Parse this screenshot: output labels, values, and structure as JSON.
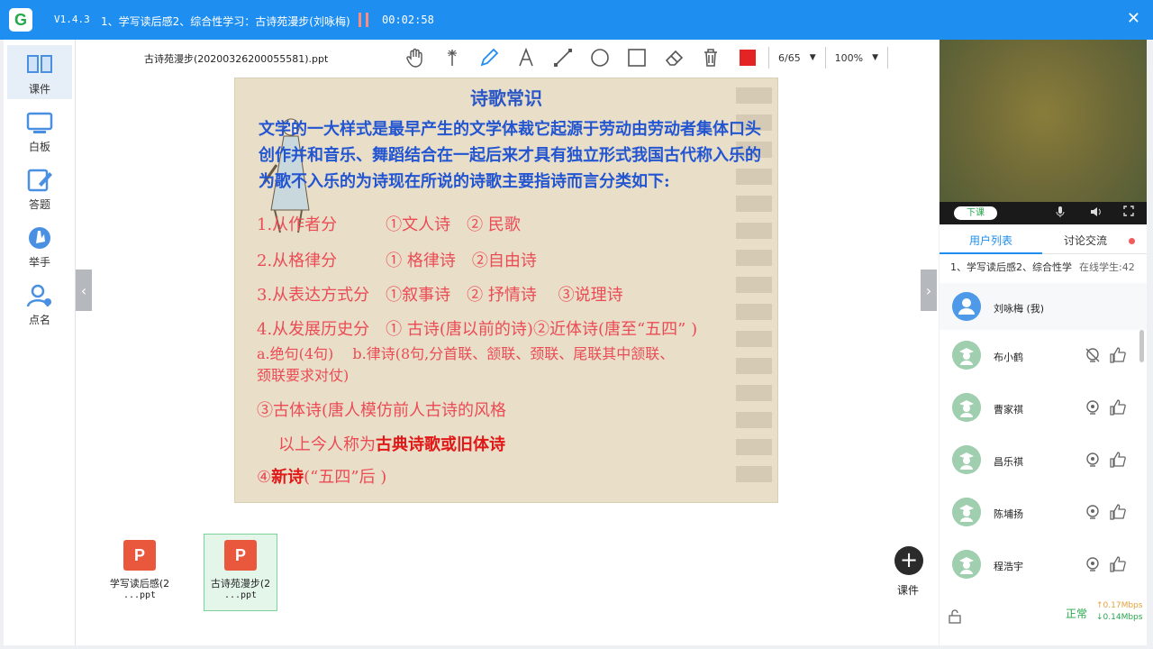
{
  "titlebar": {
    "logo_letter": "G",
    "version": "V1.4.3",
    "lesson_title": "1、学写读后感2、综合性学习：古诗苑漫步(刘咏梅)",
    "timer": "00:02:58",
    "close_glyph": "✕"
  },
  "sidebar": {
    "items": [
      {
        "label": "课件",
        "icon": "book-icon"
      },
      {
        "label": "白板",
        "icon": "whiteboard-icon"
      },
      {
        "label": "答题",
        "icon": "edit-icon"
      },
      {
        "label": "举手",
        "icon": "hand-raise-icon"
      },
      {
        "label": "点名",
        "icon": "roll-call-icon"
      }
    ]
  },
  "main": {
    "filename": "古诗苑漫步(20200326200055581).ppt",
    "page_select": "6/65",
    "zoom_select": "100%",
    "accent_color": "#e42424"
  },
  "slide": {
    "title": "诗歌常识",
    "intro": "文学的一大样式是最早产生的文学体裁它起源于劳动由劳动者集体口头创作并和音乐、舞蹈结合在一起后来才具有独立形式我国古代称入乐的为歌不入乐的为诗现在所说的诗歌主要指诗而言分类如下:",
    "line1": "1.从作者分　　　①文人诗　② 民歌",
    "line2": "2.从格律分　　　① 格律诗　②自由诗",
    "line3": "3.从表达方式分　①叙事诗　② 抒情诗　 ③说理诗",
    "line4": "4.从发展历史分　① 古诗(唐以前的诗)②近体诗(唐至“五四”  )",
    "line5": "a.绝句(4句)　 b.律诗(8句,分首联、颔联、颈联、尾联其中颔联、",
    "line6": "颈联要求对仗)",
    "line7": "③古体诗(唐人模仿前人古诗的风格",
    "line8_pre": "以上今人称为",
    "line8_strong": "古典诗歌或旧体诗",
    "line9_num": "④",
    "line9_strong": "新诗",
    "line9_rest": "(“五四”后 )"
  },
  "files": [
    {
      "name": "学写读后感(2",
      "ext": "...ppt",
      "icon_letter": "P"
    },
    {
      "name": "古诗苑漫步(2",
      "ext": "...ppt",
      "icon_letter": "P"
    }
  ],
  "add_button": {
    "glyph": "+",
    "label": "课件"
  },
  "right": {
    "end_class": "下课",
    "tab_users": "用户列表",
    "tab_discuss": "讨论交流",
    "class_name": "1、学写读后感2、综合性学",
    "online": "在线学生:42",
    "me": "刘咏梅 (我)",
    "users": [
      "布小鹤",
      "曹家祺",
      "昌乐祺",
      "陈埔扬",
      "程浩宇"
    ],
    "status": "正常",
    "up_speed": "↑0.17Mbps",
    "down_speed": "↓0.14Mbps"
  }
}
